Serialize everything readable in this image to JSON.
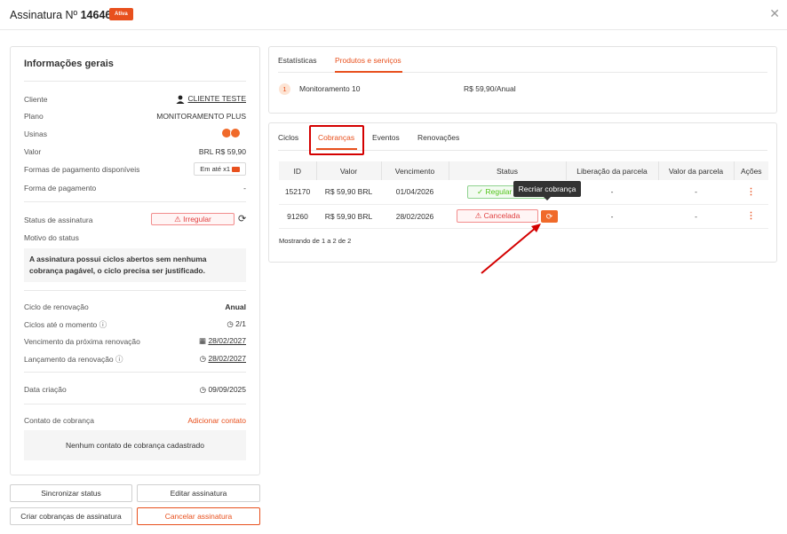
{
  "header": {
    "title_prefix": "Assinatura Nº",
    "title_number": "14646",
    "status_badge": "Ativa"
  },
  "info": {
    "title": "Informações gerais",
    "cliente_label": "Cliente",
    "cliente_value": "CLIENTE TESTE",
    "plano_label": "Plano",
    "plano_value": "MONITORAMENTO PLUS",
    "usinas_label": "Usinas",
    "valor_label": "Valor",
    "valor_value": "BRL R$ 59,90",
    "formas_label": "Formas de pagamento disponíveis",
    "formas_value": "Em até x1",
    "forma_label": "Forma de pagamento",
    "forma_value": "-",
    "status_label": "Status de assinatura",
    "status_value": "Irregular",
    "motivo_label": "Motivo do status",
    "motivo_text": "A assinatura possui ciclos abertos sem nenhuma cobrança pagável, o ciclo precisa ser justificado.",
    "ciclo_label": "Ciclo de renovação",
    "ciclo_value": "Anual",
    "ciclos_ate_label": "Ciclos até o momento",
    "ciclos_ate_value": "2/1",
    "venc_label": "Vencimento da próxima renovação",
    "venc_value": "28/02/2027",
    "lanc_label": "Lançamento da renovação",
    "lanc_value": "28/02/2027",
    "criacao_label": "Data criação",
    "criacao_value": "09/09/2025",
    "contato_label": "Contato de cobrança",
    "contato_link": "Adicionar contato",
    "contato_empty": "Nenhum contato de cobrança cadastrado"
  },
  "buttons": {
    "sincronizar": "Sincronizar status",
    "editar": "Editar assinatura",
    "criar": "Criar cobranças de assinatura",
    "cancelar": "Cancelar assinatura"
  },
  "top_tabs": [
    "Estatísticas",
    "Produtos e serviços"
  ],
  "product": {
    "index": "1",
    "name": "Monitoramento 10",
    "price": "R$ 59,90/Anual"
  },
  "sub_tabs": [
    "Ciclos",
    "Cobranças",
    "Eventos",
    "Renovações"
  ],
  "table": {
    "headers": [
      "ID",
      "Valor",
      "Vencimento",
      "Status",
      "Liberação da parcela",
      "Valor da parcela",
      "Ações"
    ],
    "rows": [
      {
        "id": "152170",
        "valor": "R$ 59,90  BRL",
        "venc": "01/04/2026",
        "status": "Regular",
        "liberacao": "-",
        "valor_parcela": "-"
      },
      {
        "id": "91260",
        "valor": "R$ 59,90  BRL",
        "venc": "28/02/2026",
        "status": "Cancelada",
        "liberacao": "-",
        "valor_parcela": "-"
      }
    ],
    "footer": "Mostrando de 1 a 2 de 2"
  },
  "tooltip": "Recriar cobrança",
  "colors": {
    "accent": "#e8501d",
    "error": "#e04040",
    "success": "#52c41a",
    "annotation": "#d40000"
  }
}
